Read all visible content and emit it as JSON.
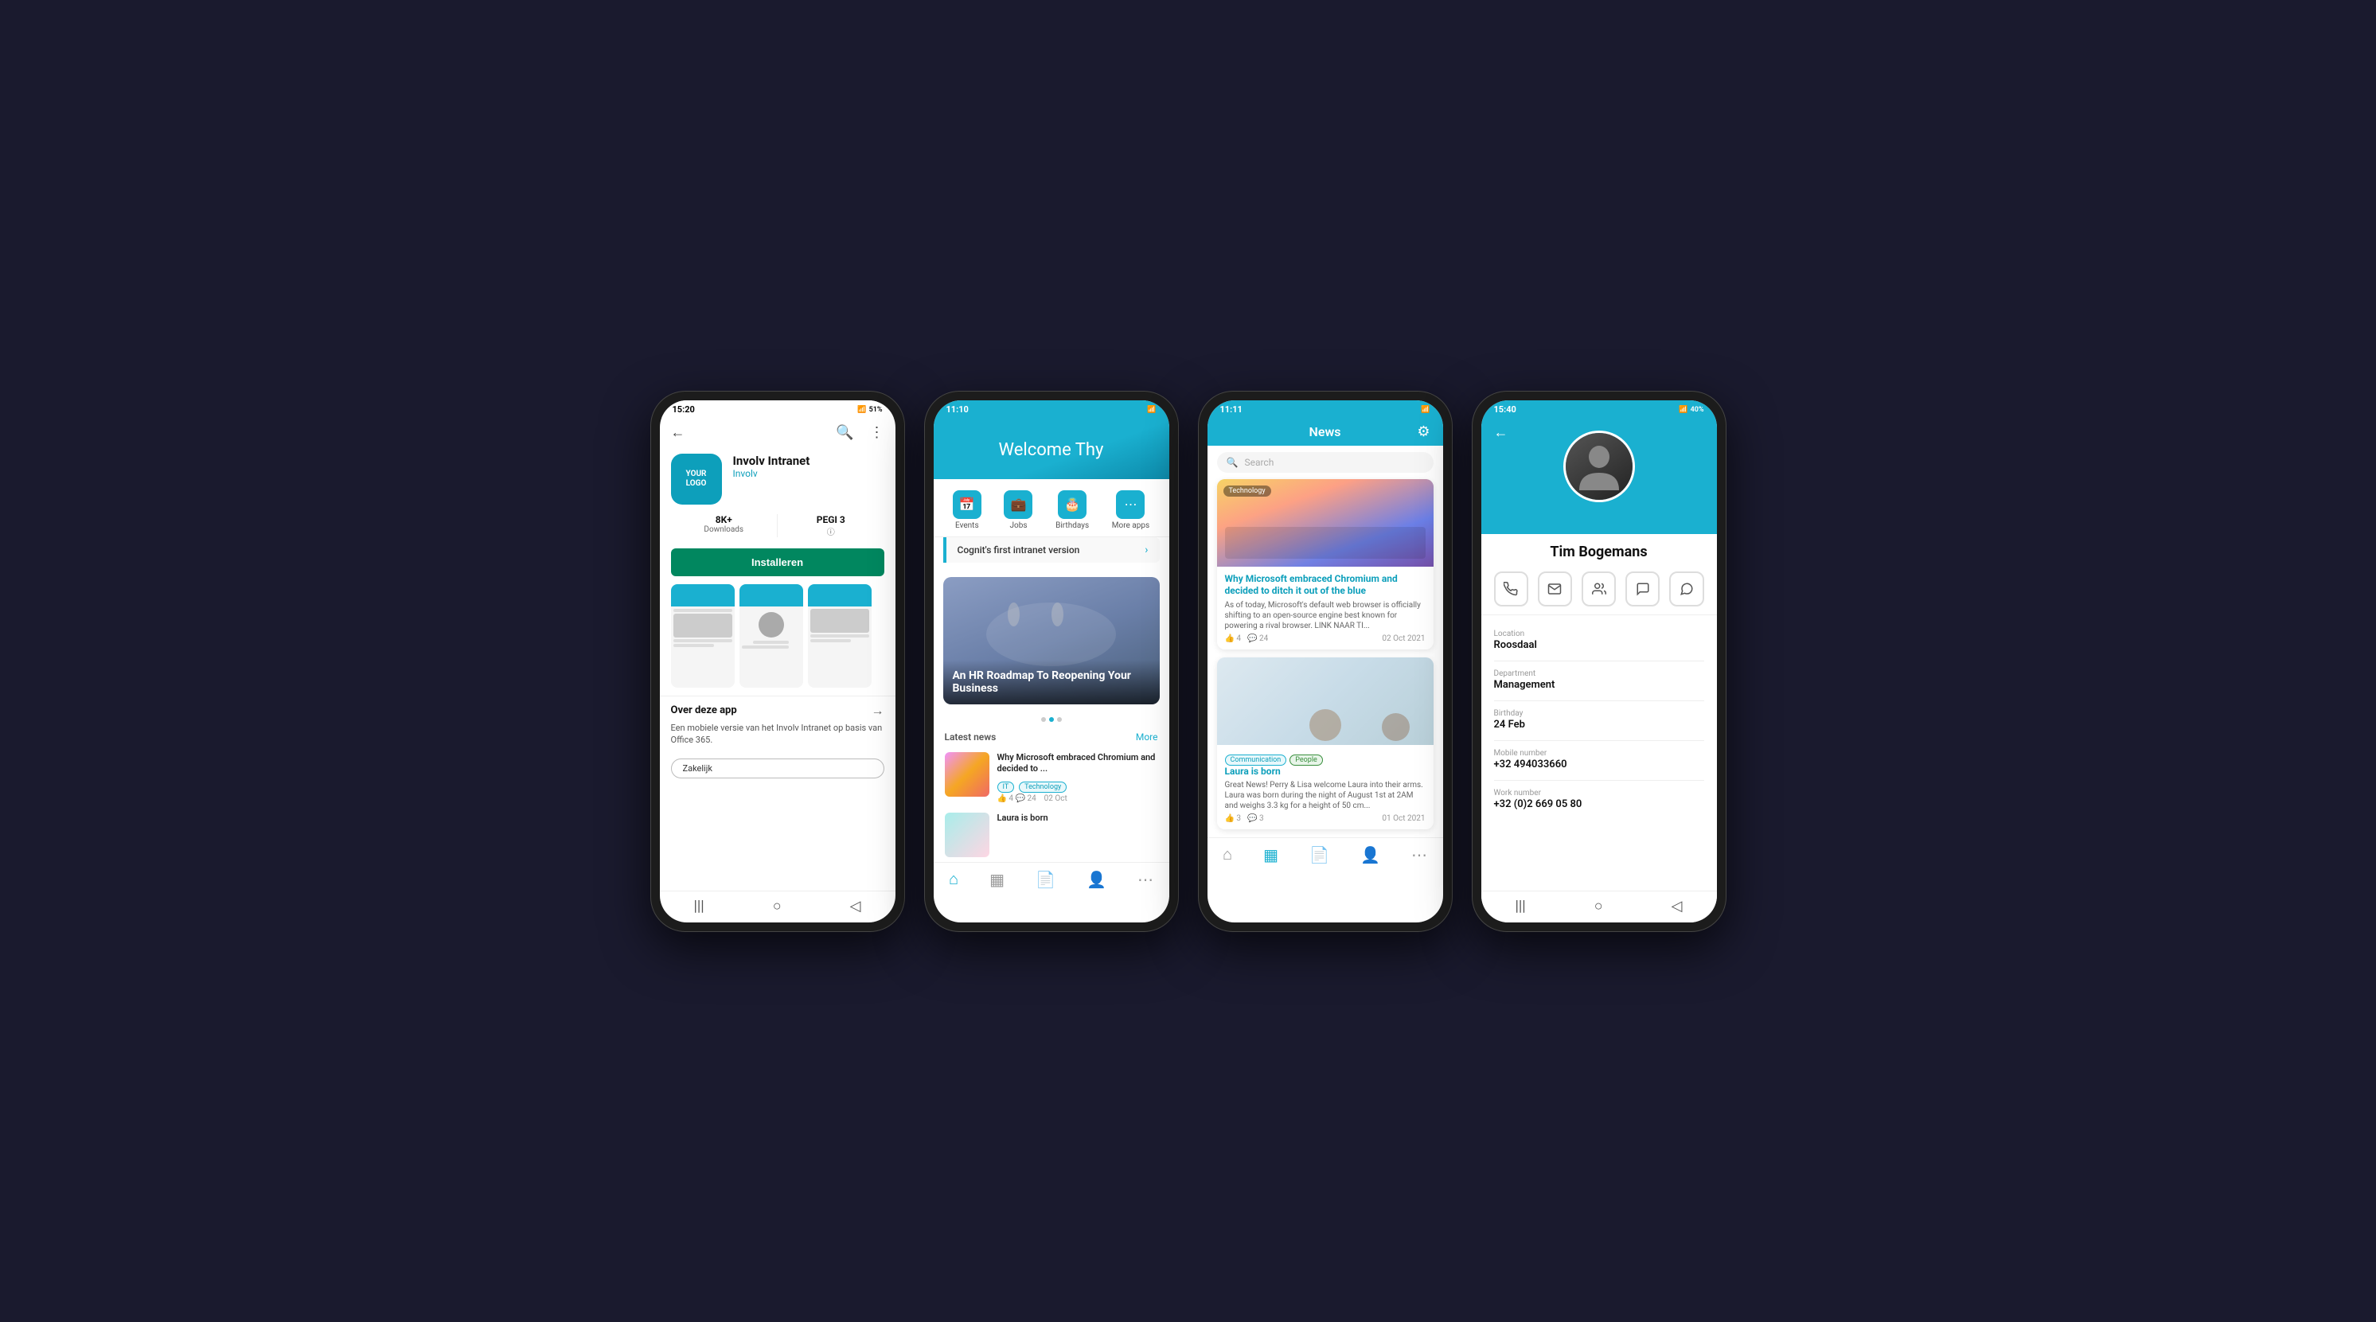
{
  "phone1": {
    "status": {
      "time": "15:20",
      "battery": "51%",
      "icons": "📶"
    },
    "header": {
      "back": "←",
      "search": "🔍",
      "menu": "⋮"
    },
    "app": {
      "logo_line1": "YOUR",
      "logo_line2": "LOGO",
      "name": "Involv Intranet",
      "developer": "Involv",
      "downloads_value": "8K+",
      "downloads_label": "Downloads",
      "pegi_value": "PEGI 3",
      "install_btn": "Installeren",
      "about_title": "Over deze app",
      "about_arrow": "→",
      "about_text": "Een mobiele versie van het Involv Intranet op basis van Office 365.",
      "zakelijk_btn": "Zakelijk"
    },
    "bottom_nav": [
      "|||",
      "○",
      "<"
    ]
  },
  "phone2": {
    "status": {
      "time": "11:10",
      "icons": "📶"
    },
    "welcome_text": "Welcome Thy",
    "quick_icons": [
      {
        "icon": "📅",
        "label": "Events"
      },
      {
        "icon": "💼",
        "label": "Jobs"
      },
      {
        "icon": "🎂",
        "label": "Birthdays"
      },
      {
        "icon": "⋯",
        "label": "More apps"
      }
    ],
    "featured_link": "Cognit's first intranet version",
    "featured_card_title": "An HR Roadmap To Reopening Your Business",
    "latest_news_title": "Latest news",
    "latest_more": "More",
    "news_items": [
      {
        "title": "Why Microsoft embraced Chromium and decided to ...",
        "tags": [
          "IT",
          "Technology"
        ],
        "likes": "4",
        "comments": "24",
        "date": "02 Oct"
      },
      {
        "title": "Laura is born",
        "tags": [],
        "likes": "",
        "comments": "",
        "date": ""
      }
    ],
    "tab_bar": [
      "🏠",
      "📋",
      "📄",
      "👤",
      "⋯"
    ]
  },
  "phone3": {
    "status": {
      "time": "11:11",
      "icons": "📶"
    },
    "header_title": "News",
    "filter_icon": "⚙",
    "search_placeholder": "Search",
    "news_cards": [
      {
        "tag": "Technology",
        "title": "Why Microsoft embraced Chromium and decided to ditch it out of the blue",
        "excerpt": "As of today, Microsoft's default web browser is officially shifting to an open-source engine best known for powering a rival browser. LINK NAAR TI...",
        "likes": "4",
        "comments": "24",
        "date": "02 Oct 2021",
        "img": "sunset"
      },
      {
        "tags": [
          "Communication",
          "People"
        ],
        "title": "Laura is born",
        "excerpt": "Great News! Perry & Lisa welcome Laura into their arms. Laura was born during the night of August 1st at 2AM and weighs 3.3 kg for a height of 50 cm...",
        "likes": "3",
        "comments": "3",
        "date": "01 Oct 2021",
        "img": "baby"
      }
    ],
    "tab_bar": [
      "🏠",
      "📋",
      "📄",
      "👤",
      "⋯"
    ],
    "active_tab": 1
  },
  "phone4": {
    "status": {
      "time": "15:40",
      "battery": "40%",
      "icons": "📶"
    },
    "back": "←",
    "name": "Tim Bogemans",
    "actions": [
      "📞",
      "✉",
      "👥",
      "💬",
      "💬"
    ],
    "details": [
      {
        "label": "Location",
        "value": "Roosdaal"
      },
      {
        "label": "Department",
        "value": "Management"
      },
      {
        "label": "Birthday",
        "value": "24 Feb"
      },
      {
        "label": "Mobile number",
        "value": "+32 494033660"
      },
      {
        "label": "Work number",
        "value": "+32 (0)2 669 05 80"
      }
    ],
    "bottom_nav": [
      "|||",
      "○",
      "<"
    ]
  }
}
